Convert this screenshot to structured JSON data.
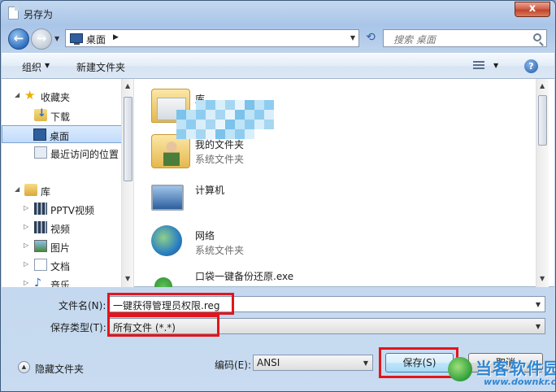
{
  "window": {
    "title": "另存为",
    "close_label": "x"
  },
  "navigation": {
    "address_location": "桌面",
    "search_placeholder": "搜索 桌面"
  },
  "toolbar": {
    "organize_label": "组织",
    "new_folder_label": "新建文件夹",
    "help_label": "?"
  },
  "nav_pane": {
    "items": [
      {
        "label": "收藏夹",
        "icon": "star-icon"
      },
      {
        "label": "下载",
        "icon": "download-folder-icon"
      },
      {
        "label": "桌面",
        "icon": "desktop-icon",
        "selected": true
      },
      {
        "label": "最近访问的位置",
        "icon": "recent-places-icon"
      },
      {
        "label": "库",
        "icon": "library-icon"
      },
      {
        "label": "PPTV视频",
        "icon": "video-library-icon"
      },
      {
        "label": "视频",
        "icon": "video-library-icon"
      },
      {
        "label": "图片",
        "icon": "pictures-icon"
      },
      {
        "label": "文档",
        "icon": "documents-icon"
      },
      {
        "label": "音乐",
        "icon": "music-icon"
      }
    ]
  },
  "files": [
    {
      "name": "库",
      "type": "系统文件夹",
      "icon": "library-folder-icon"
    },
    {
      "name": "我的文件夹",
      "type": "系统文件夹",
      "icon": "user-folder-icon"
    },
    {
      "name": "计算机",
      "type": "",
      "icon": "computer-icon"
    },
    {
      "name": "网络",
      "type": "系统文件夹",
      "icon": "network-icon"
    },
    {
      "name": "口袋一键备份还原.exe",
      "type": "",
      "icon": "exe-icon"
    }
  ],
  "form": {
    "filename_label": "文件名(N):",
    "filename_value": "一键获得管理员权限.reg",
    "filetype_label": "保存类型(T):",
    "filetype_value": "所有文件  (*.*)",
    "encoding_label": "编码(E):",
    "encoding_value": "ANSI",
    "save_label": "保存(S)",
    "cancel_label": "取消",
    "hide_folders_label": "隐藏文件夹"
  },
  "watermark": {
    "text": "当客软件园",
    "url": "www.downkr.com"
  },
  "colors": {
    "highlight": "#e2151b",
    "accent": "#2f86d3"
  }
}
